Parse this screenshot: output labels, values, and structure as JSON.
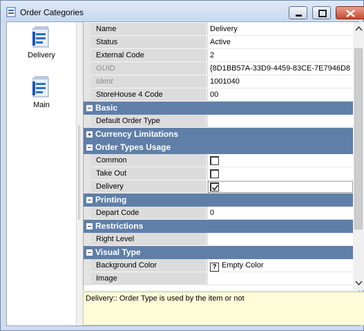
{
  "window": {
    "title": "Order Categories"
  },
  "nav": {
    "items": [
      {
        "label": "Delivery"
      },
      {
        "label": "Main"
      }
    ]
  },
  "grid": {
    "rows": [
      {
        "kind": "prop",
        "name": "Name",
        "value": "Delivery"
      },
      {
        "kind": "prop",
        "name": "Status",
        "value": "Active"
      },
      {
        "kind": "prop",
        "name": "External Code",
        "value": "2"
      },
      {
        "kind": "prop",
        "name": "GUID",
        "value": "{8D1BB57A-33D9-4459-83CE-7E7946D8",
        "disabled": true
      },
      {
        "kind": "prop",
        "name": "Ident",
        "value": "1001040",
        "disabled": true
      },
      {
        "kind": "prop",
        "name": "StoreHouse 4 Code",
        "value": "00"
      },
      {
        "kind": "cat",
        "name": "Basic",
        "expanded": true
      },
      {
        "kind": "prop",
        "name": "Default Order Type",
        "value": ""
      },
      {
        "kind": "cat",
        "name": "Currency Limitations",
        "expanded": false
      },
      {
        "kind": "cat",
        "name": "Order Types Usage",
        "expanded": true
      },
      {
        "kind": "check",
        "name": "Common",
        "checked": false
      },
      {
        "kind": "check",
        "name": "Take Out",
        "checked": false
      },
      {
        "kind": "check",
        "name": "Delivery",
        "checked": true,
        "focused": true
      },
      {
        "kind": "cat",
        "name": "Printing",
        "expanded": true
      },
      {
        "kind": "prop",
        "name": "Depart Code",
        "value": "0"
      },
      {
        "kind": "cat",
        "name": "Restrictions",
        "expanded": true
      },
      {
        "kind": "prop",
        "name": "Right Level",
        "value": ""
      },
      {
        "kind": "cat",
        "name": "Visual Type",
        "expanded": true
      },
      {
        "kind": "color",
        "name": "Background Color",
        "value": "Empty Color",
        "icon": "?"
      },
      {
        "kind": "prop",
        "name": "Image",
        "value": ""
      }
    ]
  },
  "description": {
    "text": "Delivery:: Order Type is used by the item or not"
  },
  "colors": {
    "category_header": "#5f7fa8",
    "description_bg": "#fdfbd8"
  }
}
